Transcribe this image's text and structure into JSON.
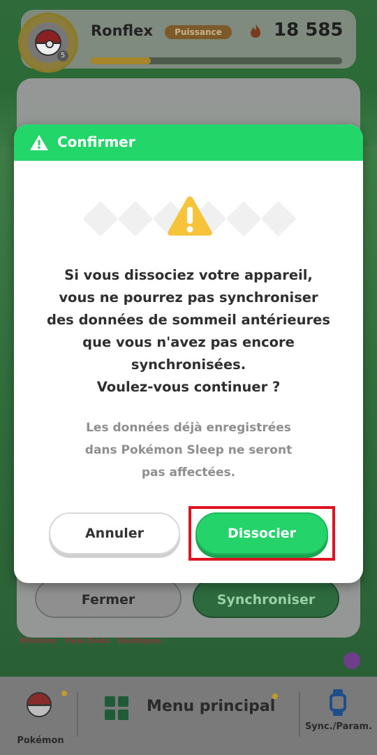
{
  "header": {
    "player_name": "Ronflex",
    "power_label": "Puissance",
    "power_value": "18 585",
    "level": "5",
    "progress": 0.24
  },
  "background": {
    "close_label": "Fermer",
    "sync_label": "Synchroniser",
    "tabs": [
      "Missions",
      "Pass'Dodo",
      "Boutiques"
    ]
  },
  "modal": {
    "title": "Confirmer",
    "message_lines": [
      "Si vous dissociez votre appareil,",
      "vous ne pourrez pas synchroniser",
      "des données de sommeil antérieures",
      "que vous n'avez pas encore",
      "synchronisées.",
      "Voulez-vous continuer ?"
    ],
    "note_lines": [
      "Les données déjà enregistrées",
      "dans Pokémon Sleep ne seront",
      "pas affectées."
    ],
    "cancel_label": "Annuler",
    "confirm_label": "Dissocier"
  },
  "bottom_nav": {
    "pokemon_label": "Pokémon",
    "main_menu_label": "Menu principal",
    "sync_label": "Sync./Param."
  },
  "colors": {
    "accent_green": "#23d66a",
    "highlight_red": "#e0121f",
    "warning_yellow": "#f7c33a"
  }
}
